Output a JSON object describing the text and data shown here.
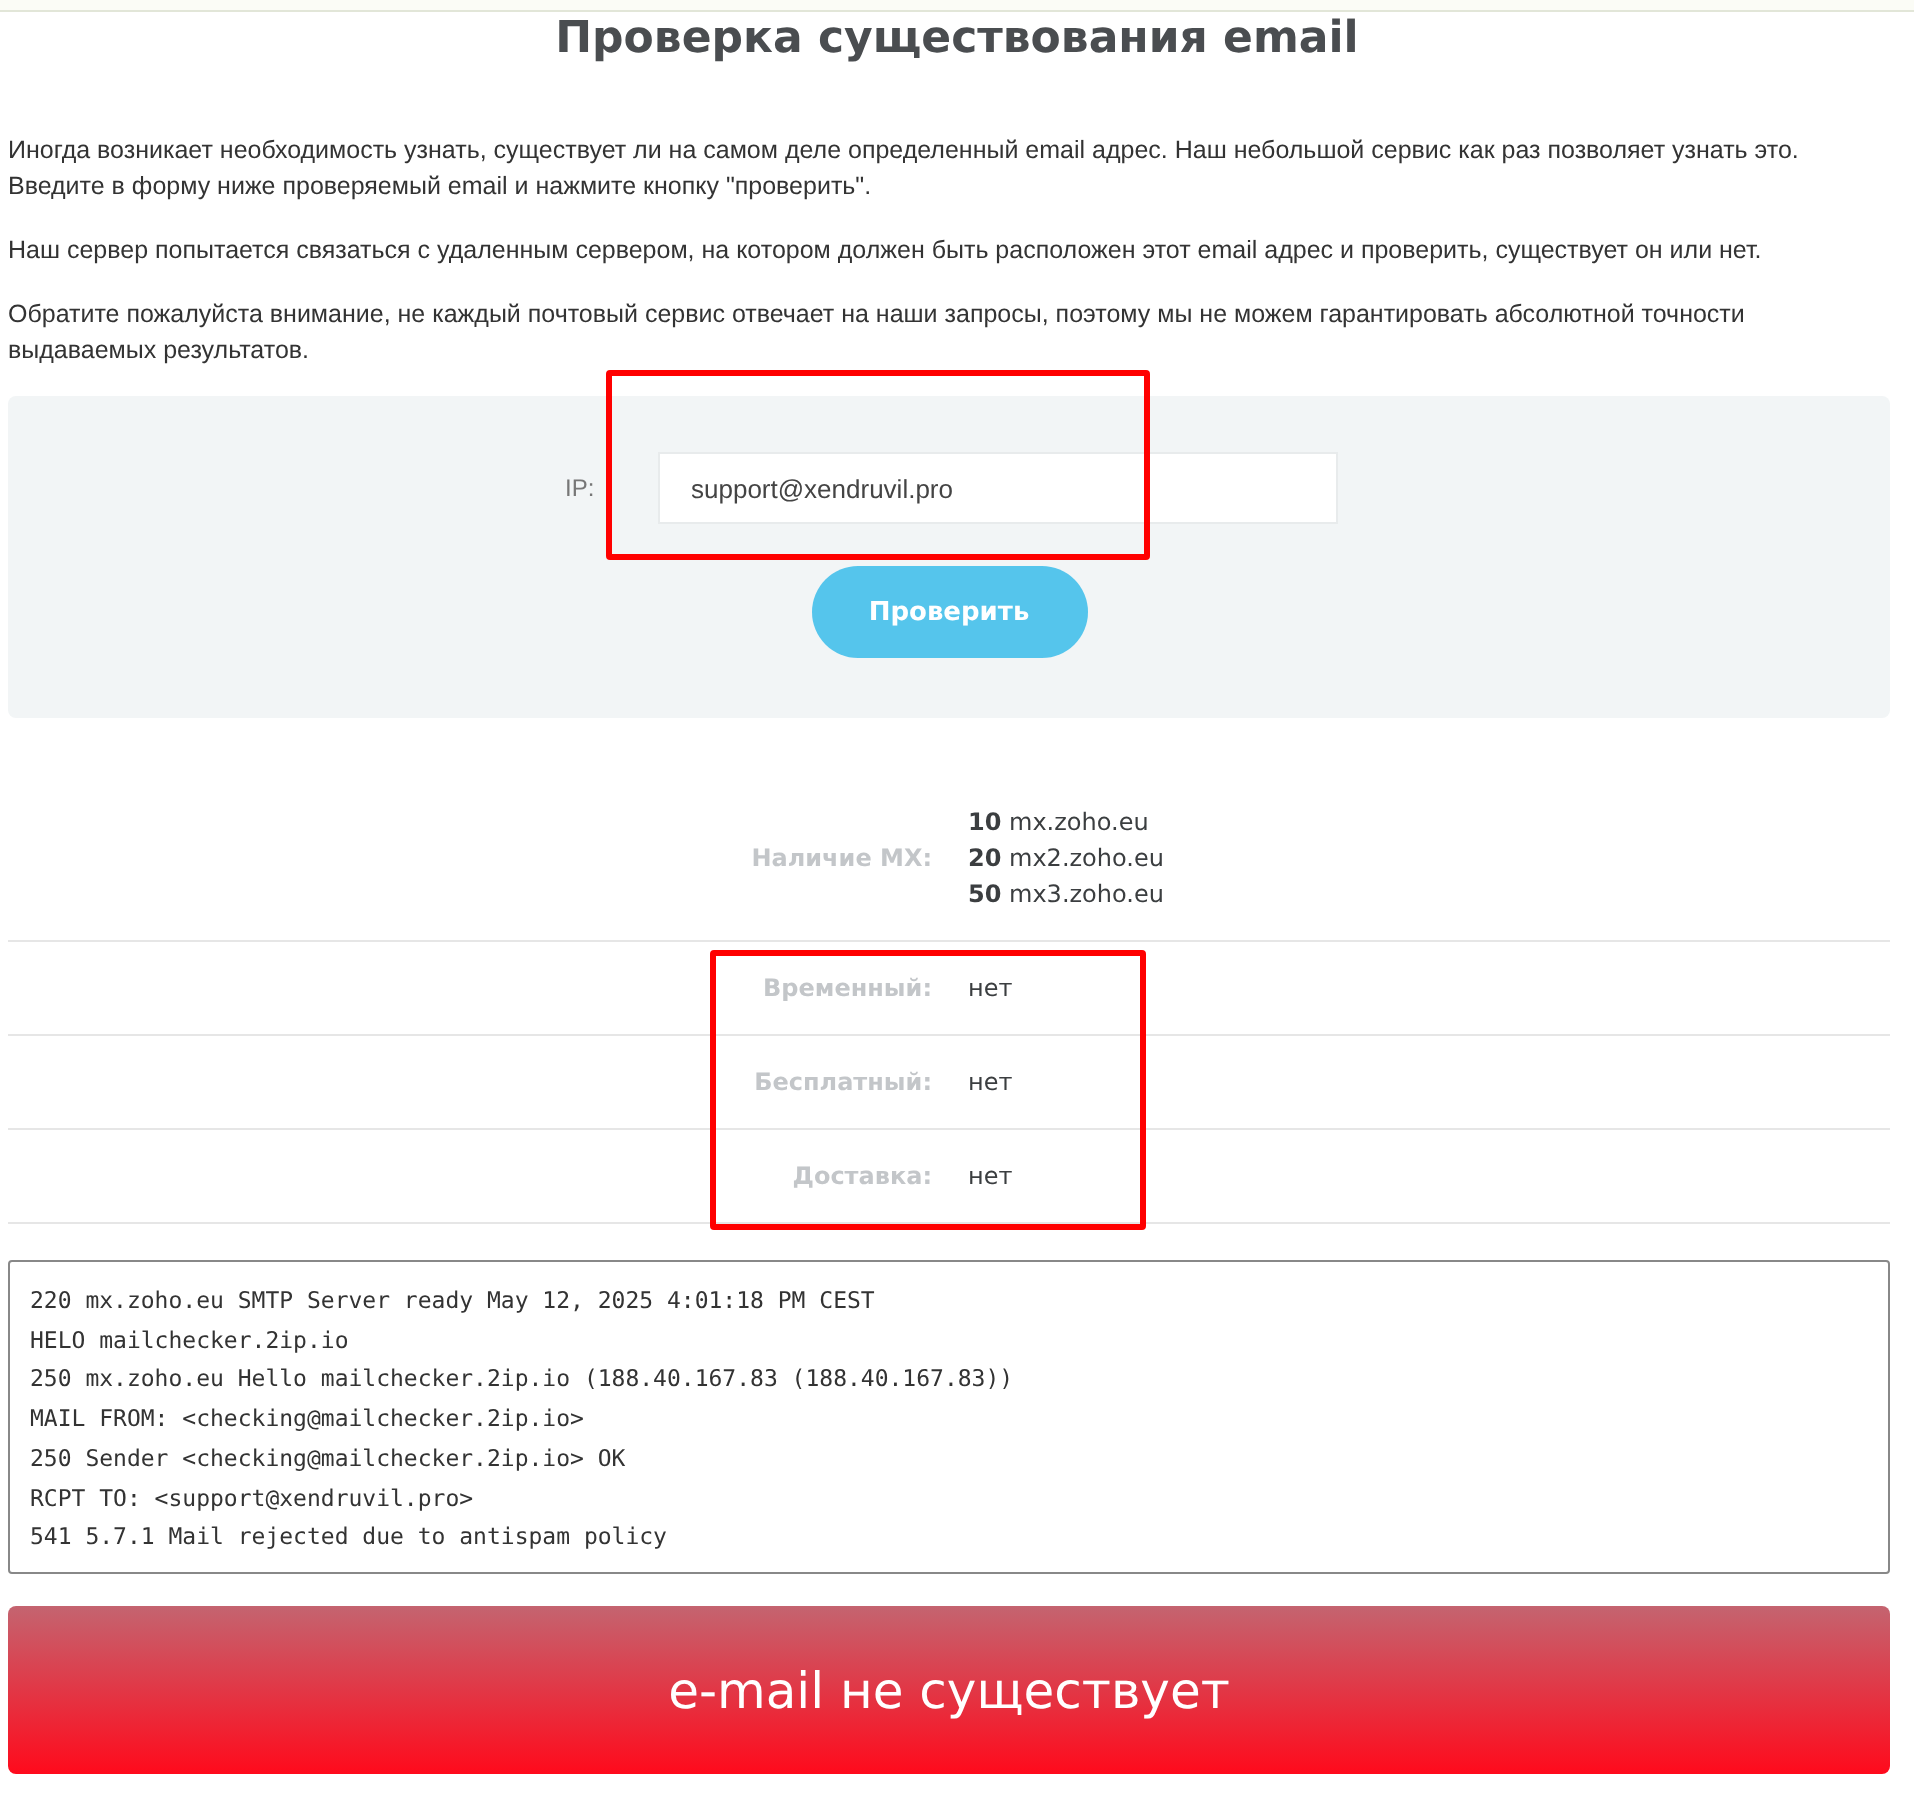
{
  "title": "Проверка существования email",
  "paragraphs": [
    "Иногда возникает необходимость узнать, существует ли на самом деле определенный email адрес. Наш небольшой сервис как раз позволяет узнать это. Введите в форму ниже проверяемый email и нажмите кнопку \"проверить\".",
    "Наш сервер попытается связаться с удаленным сервером, на котором должен быть расположен этот email адрес и проверить, существует он или нет.",
    "Обратите пожалуйста внимание, не каждый почтовый сервис отвечает на наши запросы, поэтому мы не можем гарантировать абсолютной точности выдаваемых результатов."
  ],
  "form": {
    "label": "IP:",
    "value": "support@xendruvil.pro",
    "button": "Проверить",
    "highlighted": true
  },
  "results": [
    {
      "label": "Наличие MX:",
      "values": [
        "**10** mx.zoho.eu",
        "**20** mx2.zoho.eu",
        "**50** mx3.zoho.eu"
      ],
      "highlighted": false
    },
    {
      "label": "Временный:",
      "values": [
        "нет"
      ],
      "highlighted": true
    },
    {
      "label": "Бесплатный:",
      "values": [
        "нет"
      ],
      "highlighted": true
    },
    {
      "label": "Доставка:",
      "values": [
        "нет"
      ],
      "highlighted": true
    }
  ],
  "log": [
    "220 mx.zoho.eu SMTP Server ready May 12, 2025 4:01:18 PM CEST",
    "HELO mailchecker.2ip.io",
    "250 mx.zoho.eu Hello mailchecker.2ip.io (188.40.167.83 (188.40.167.83))",
    "MAIL FROM: <checking@mailchecker.2ip.io>",
    "250 Sender <checking@mailchecker.2ip.io> OK",
    "RCPT TO: <support@xendruvil.pro>",
    "541 5.7.1 Mail rejected due to antispam policy"
  ],
  "verdict": "e-mail не существует"
}
